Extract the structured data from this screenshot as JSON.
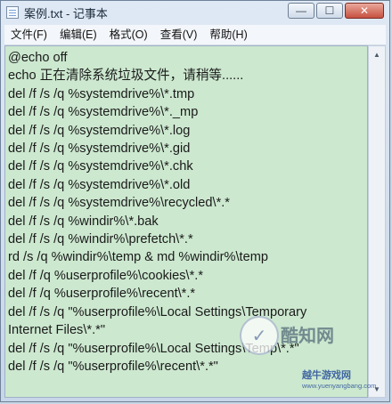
{
  "window": {
    "title": "案例.txt - 记事本",
    "minimize_glyph": "—",
    "maximize_glyph": "☐",
    "close_glyph": "✕"
  },
  "menu": [
    {
      "label": "文件(F)"
    },
    {
      "label": "编辑(E)"
    },
    {
      "label": "格式(O)"
    },
    {
      "label": "查看(V)"
    },
    {
      "label": "帮助(H)"
    }
  ],
  "editor": {
    "background": "#cce8cf",
    "lines": [
      "@echo off",
      "echo 正在清除系统垃圾文件，请稍等......",
      "del /f /s /q %systemdrive%\\*.tmp",
      "del /f /s /q %systemdrive%\\*._mp",
      "del /f /s /q %systemdrive%\\*.log",
      "del /f /s /q %systemdrive%\\*.gid",
      "del /f /s /q %systemdrive%\\*.chk",
      "del /f /s /q %systemdrive%\\*.old",
      "del /f /s /q %systemdrive%\\recycled\\*.*",
      "del /f /s /q %windir%\\*.bak",
      "del /f /s /q %windir%\\prefetch\\*.*",
      "rd /s /q %windir%\\temp & md %windir%\\temp",
      "del /f /q %userprofile%\\cookies\\*.*",
      "del /f /q %userprofile%\\recent\\*.*",
      "del /f /s /q \"%userprofile%\\Local Settings\\Temporary",
      "Internet Files\\*.*\"",
      "del /f /s /q \"%userprofile%\\Local Settings\\Temp\\*.*\"",
      "del /f /s /q \"%userprofile%\\recent\\*.*\""
    ]
  },
  "scrollbar": {
    "up_glyph": "▲",
    "down_glyph": "▼"
  },
  "watermark": {
    "brand": "酷知网",
    "site": "越牛游戏网",
    "url": "www.yuenyangbang.com"
  }
}
